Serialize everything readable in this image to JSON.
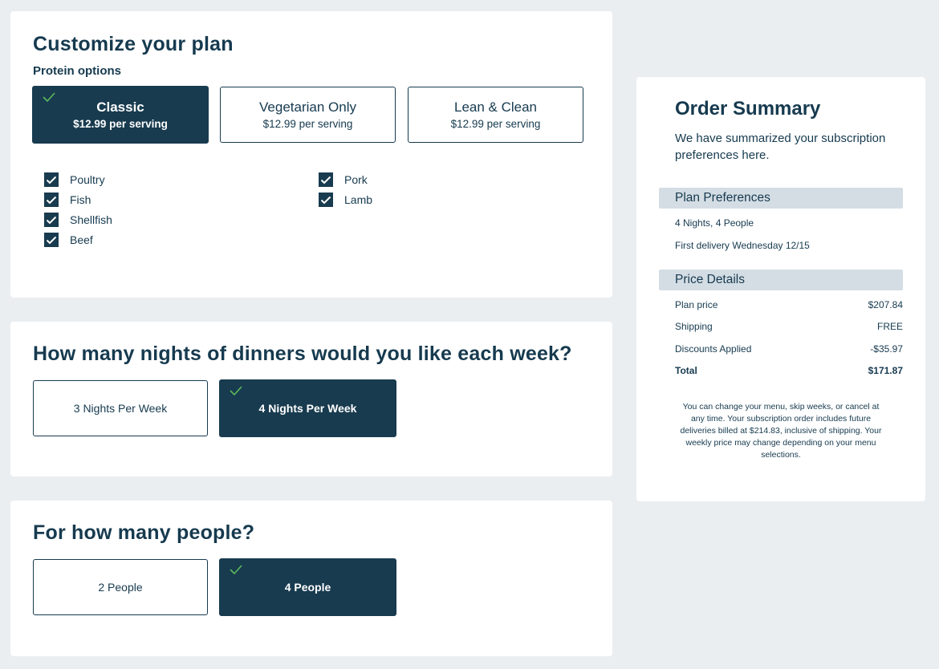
{
  "plan": {
    "title": "Customize your plan",
    "protein_label": "Protein options",
    "options": [
      {
        "name": "Classic",
        "price": "$12.99 per serving",
        "selected": true
      },
      {
        "name": "Vegetarian Only",
        "price": "$12.99 per serving",
        "selected": false
      },
      {
        "name": "Lean & Clean",
        "price": "$12.99 per serving",
        "selected": false
      }
    ],
    "proteins_left": [
      {
        "label": "Poultry",
        "checked": true
      },
      {
        "label": "Fish",
        "checked": true
      },
      {
        "label": "Shellfish",
        "checked": true
      },
      {
        "label": "Beef",
        "checked": true
      }
    ],
    "proteins_right": [
      {
        "label": "Pork",
        "checked": true
      },
      {
        "label": "Lamb",
        "checked": true
      }
    ]
  },
  "nights": {
    "title": "How many nights of dinners would you like each week?",
    "options": [
      {
        "label": "3 Nights Per Week",
        "selected": false
      },
      {
        "label": "4 Nights Per Week",
        "selected": true
      }
    ]
  },
  "people": {
    "title": "For how many people?",
    "options": [
      {
        "label": "2 People",
        "selected": false
      },
      {
        "label": "4 People",
        "selected": true
      }
    ]
  },
  "summary": {
    "title": "Order Summary",
    "description": "We have summarized your subscription preferences here.",
    "plan_preferences": {
      "heading": "Plan Preferences",
      "lines": [
        "4 Nights, 4 People",
        "First delivery Wednesday 12/15"
      ]
    },
    "price_details": {
      "heading": "Price Details",
      "rows": [
        {
          "label": "Plan price",
          "value": "$207.84"
        },
        {
          "label": "Shipping",
          "value": "FREE"
        },
        {
          "label": "Discounts Applied",
          "value": "-$35.97"
        },
        {
          "label": "Total",
          "value": "$171.87"
        }
      ]
    },
    "disclaimer": "You can change your menu, skip weeks, or cancel at any time. Your subscription order includes future deliveries billed at $214.83, inclusive of shipping. Your weekly price may change depending on your menu selections."
  },
  "colors": {
    "primary": "#183b4f",
    "check_green": "#5cb85c",
    "background": "#eaeef0",
    "section_bar": "#d4dde4"
  }
}
